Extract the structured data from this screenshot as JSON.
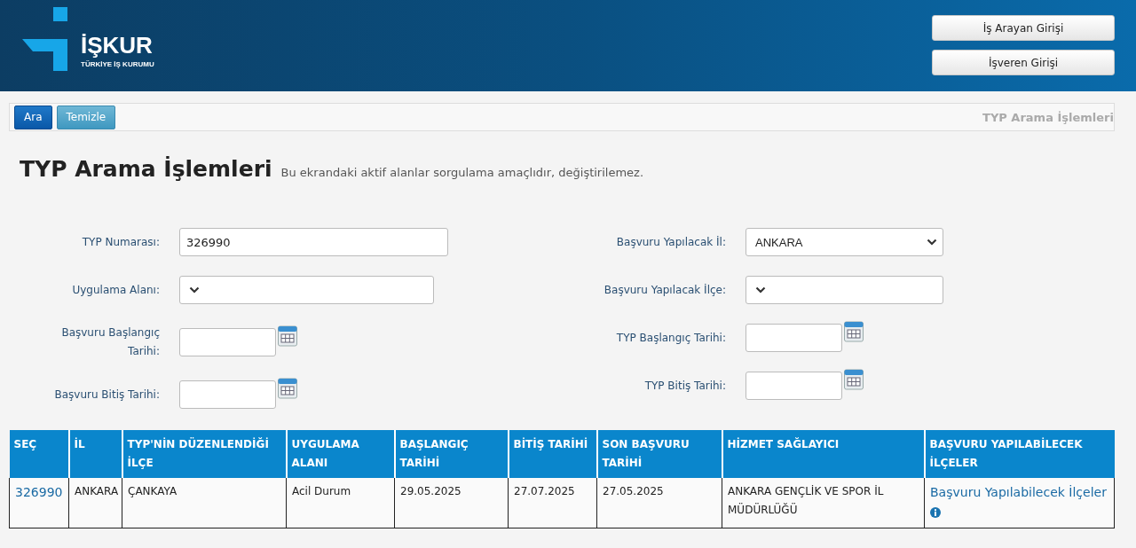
{
  "header": {
    "logo_name": "İŞKUR",
    "logo_subtitle": "TÜRKİYE İŞ KURUMU",
    "buttons": [
      "İş Arayan Girişi",
      "İşveren Girişi"
    ]
  },
  "toolbar": {
    "buttons": [
      {
        "label": "Ara",
        "kind": "primary"
      },
      {
        "label": "Temizle",
        "kind": "secondary"
      }
    ],
    "title": "TYP Arama İşlemleri"
  },
  "page": {
    "title": "TYP Arama İşlemleri",
    "subtitle": "Bu ekrandaki aktif alanlar sorgulama amaçlıdır, değiştirilemez."
  },
  "form": {
    "left": [
      {
        "label": "TYP Numarası:",
        "kind": "text",
        "value": "326990"
      },
      {
        "label": "Uygulama Alanı:",
        "kind": "select"
      },
      {
        "label": "Başvuru Başlangıç Tarihi:",
        "kind": "date"
      },
      {
        "label": "Başvuru Bitiş Tarihi:",
        "kind": "date"
      }
    ],
    "right": [
      {
        "label": "Başvuru Yapılacak İl:",
        "kind": "select",
        "value": "ANKARA"
      },
      {
        "label": "Başvuru Yapılacak İlçe:",
        "kind": "select"
      },
      {
        "label": "TYP Başlangıç Tarihi:",
        "kind": "date"
      },
      {
        "label": "TYP Bitiş Tarihi:",
        "kind": "date"
      }
    ]
  },
  "table": {
    "columns": [
      "SEÇ",
      "İL",
      "TYP'NİN DÜZENLENDİĞİ İLÇE",
      "UYGULAMA ALANI",
      "BAŞLANGIÇ TARİHİ",
      "BİTİŞ TARİHİ",
      "SON BAŞVURU TARİHİ",
      "HİZMET SAĞLAYICI",
      "BAŞVURU YAPILABİLECEK İLÇELER"
    ],
    "rows": [
      {
        "cells": [
          {
            "kind": "link",
            "text": "326990"
          },
          {
            "kind": "text",
            "text": "ANKARA"
          },
          {
            "kind": "text",
            "text": "ÇANKAYA"
          },
          {
            "kind": "text",
            "text": "Acil Durum"
          },
          {
            "kind": "text",
            "text": "29.05.2025"
          },
          {
            "kind": "text",
            "text": "27.07.2025"
          },
          {
            "kind": "text",
            "text": "27.05.2025"
          },
          {
            "kind": "text",
            "text": "ANKARA GENÇLİK VE SPOR İL MÜDÜRLÜĞÜ"
          },
          {
            "kind": "link_info",
            "text": "Başvuru Yapılabilecek İlçeler"
          }
        ]
      }
    ]
  }
}
